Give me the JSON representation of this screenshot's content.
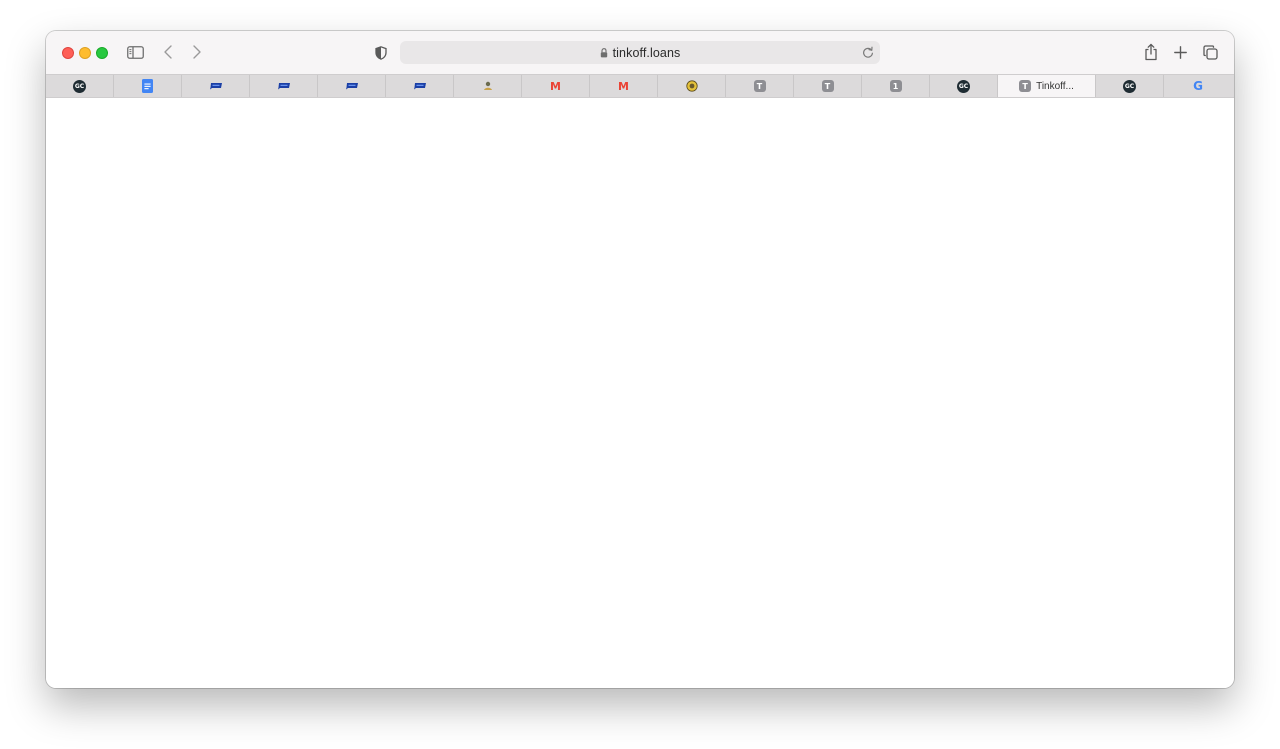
{
  "browser": {
    "address_bar": {
      "url": "tinkoff.loans",
      "secure": true
    },
    "tabs": [
      {
        "icon": "gc-logo-icon",
        "title": ""
      },
      {
        "icon": "google-docs-icon",
        "title": ""
      },
      {
        "icon": "blue-chat-bubble-icon",
        "title": ""
      },
      {
        "icon": "blue-chat-bubble-icon",
        "title": ""
      },
      {
        "icon": "blue-chat-bubble-icon",
        "title": ""
      },
      {
        "icon": "blue-chat-bubble-icon",
        "title": ""
      },
      {
        "icon": "small-figure-icon",
        "title": ""
      },
      {
        "icon": "gmail-icon",
        "title": ""
      },
      {
        "icon": "gmail-icon",
        "title": ""
      },
      {
        "icon": "crest-icon",
        "title": ""
      },
      {
        "icon": "t-letter-icon",
        "title": "",
        "letter": "T"
      },
      {
        "icon": "t-letter-icon",
        "title": "",
        "letter": "T"
      },
      {
        "icon": "one-letter-icon",
        "title": "",
        "letter": "1"
      },
      {
        "icon": "gc-logo-icon",
        "title": ""
      },
      {
        "icon": "t-letter-icon",
        "title": "Tinkoff...",
        "letter": "T",
        "active": true
      },
      {
        "icon": "gc-logo-icon",
        "title": ""
      },
      {
        "icon": "google-g-icon",
        "title": "",
        "letter": "G"
      }
    ],
    "gc_label": "GC",
    "gmail_letter": "M"
  }
}
